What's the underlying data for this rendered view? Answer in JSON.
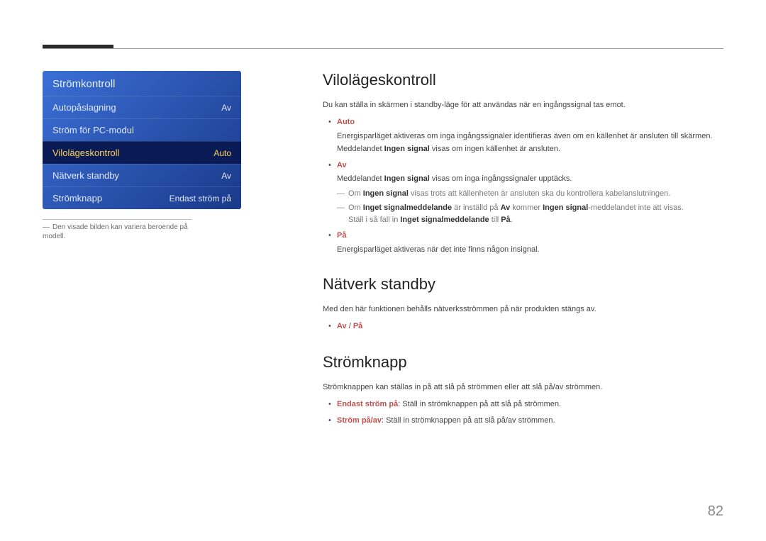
{
  "menu": {
    "title": "Strömkontroll",
    "rows": [
      {
        "label": "Autopåslagning",
        "value": "Av"
      },
      {
        "label": "Ström för PC-modul",
        "value": ""
      },
      {
        "label": "Vilolägeskontroll",
        "value": "Auto"
      },
      {
        "label": "Nätverk standby",
        "value": "Av"
      },
      {
        "label": "Strömknapp",
        "value": "Endast ström på"
      }
    ]
  },
  "footnote": {
    "dash": "―",
    "text": "Den visade bilden kan variera beroende på modell."
  },
  "sections": {
    "viloge": {
      "title": "Vilolägeskontroll",
      "intro": "Du kan ställa in skärmen i standby-läge för att användas när en ingångssignal tas emot.",
      "auto_label": "Auto",
      "auto_desc1": "Energisparläget aktiveras om inga ingångssignaler identifieras även om en källenhet är ansluten till skärmen.",
      "auto_desc2a": "Meddelandet ",
      "auto_desc2b": "Ingen signal",
      "auto_desc2c": " visas om ingen källenhet är ansluten.",
      "av_label": "Av",
      "av_desc_a": "Meddelandet ",
      "av_desc_b": "Ingen signal",
      "av_desc_c": " visas om inga ingångssignaler upptäcks.",
      "note1_a": "Om ",
      "note1_b": "Ingen signal",
      "note1_c": " visas trots att källenheten är ansluten ska du kontrollera kabelanslutningen.",
      "note2_a": "Om ",
      "note2_b": "Inget signalmeddelande",
      "note2_c": " är inställd på ",
      "note2_d": "Av",
      "note2_e": " kommer ",
      "note2_f": "Ingen signal",
      "note2_g": "-meddelandet inte att visas.",
      "note2_line2_a": "Ställ i så fall in ",
      "note2_line2_b": "Inget signalmeddelande",
      "note2_line2_c": " till ",
      "note2_line2_d": "På",
      "note2_line2_e": ".",
      "pa_label": "På",
      "pa_desc": "Energisparläget aktiveras när det inte finns någon insignal."
    },
    "natverk": {
      "title": "Nätverk standby",
      "intro": "Med den här funktionen behålls nätverksströmmen på när produkten stängs av.",
      "opt_av": "Av",
      "opt_sep": " / ",
      "opt_pa": "På"
    },
    "stromknapp": {
      "title": "Strömknapp",
      "intro": "Strömknappen kan ställas in på att slå på strömmen eller att slå på/av strömmen.",
      "b1_label": "Endast ström på",
      "b1_text": ": Ställ in strömknappen på att slå på strömmen.",
      "b2_label": "Ström på/av",
      "b2_text": ": Ställ in strömknappen på att slå på/av strömmen."
    }
  },
  "page_number": "82"
}
